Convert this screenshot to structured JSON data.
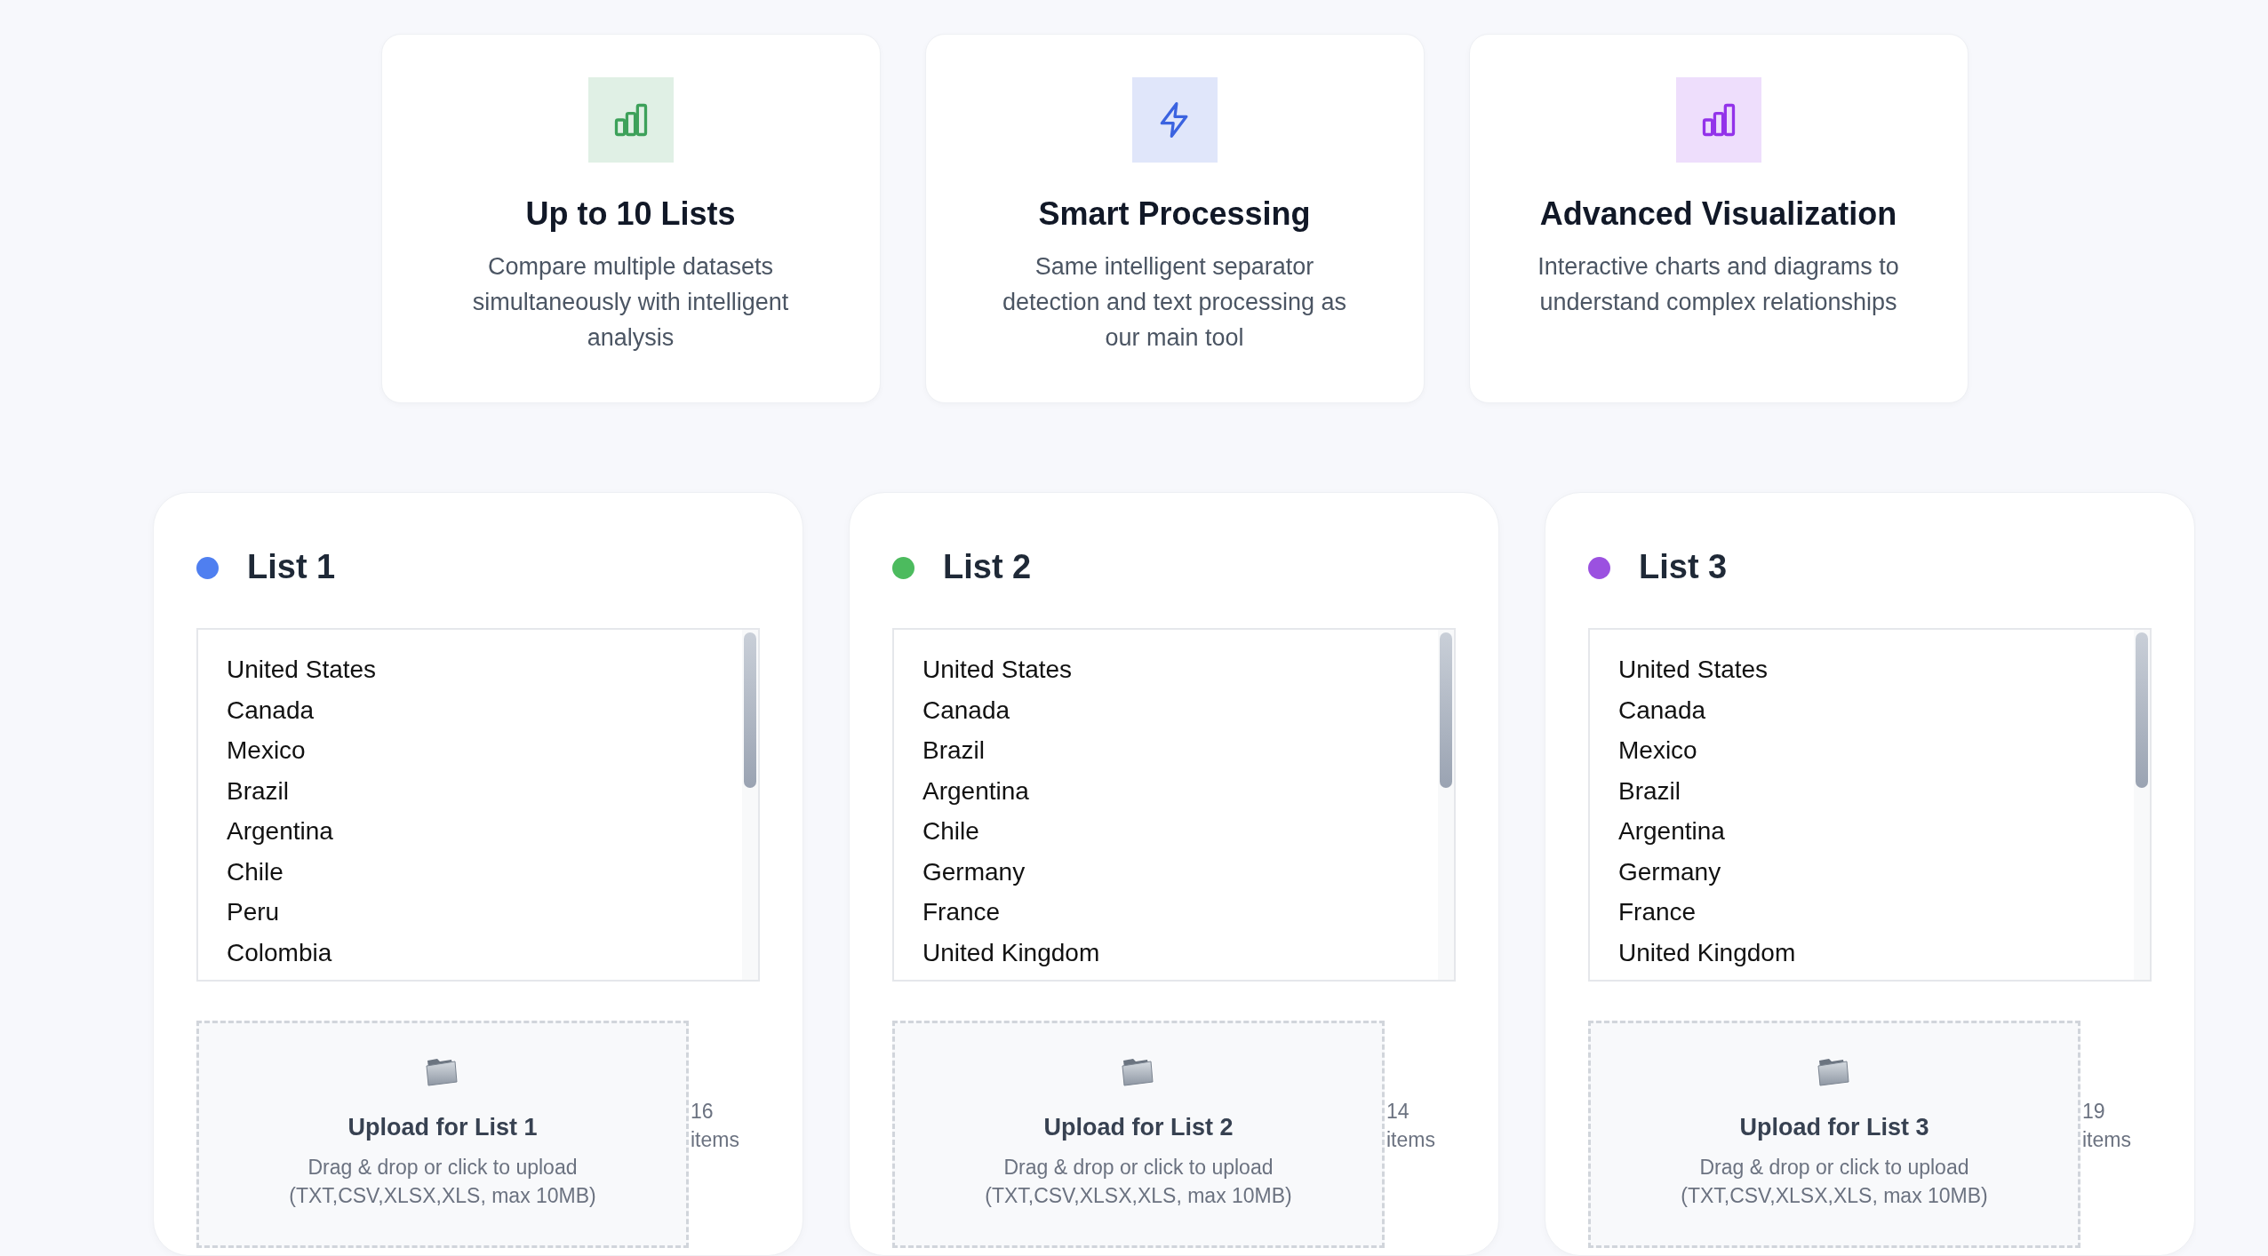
{
  "features": [
    {
      "kind": "chart",
      "color": "#3da15a",
      "title": "Up to 10 Lists",
      "description": "Compare multiple datasets simultaneously with intelligent analysis"
    },
    {
      "kind": "bolt",
      "color": "#3b63e0",
      "title": "Smart Processing",
      "description": "Same intelligent separator detection and text processing as our main tool"
    },
    {
      "kind": "chart",
      "color": "#9333ea",
      "title": "Advanced Visualization",
      "description": "Interactive charts and diagrams to understand complex relationships"
    }
  ],
  "lists": [
    {
      "title": "List 1",
      "color": "#4f7ff0",
      "items": [
        "United States",
        "Canada",
        "Mexico",
        "Brazil",
        "Argentina",
        "Chile",
        "Peru",
        "Colombia"
      ],
      "upload_title": "Upload for List 1",
      "upload_hint": "Drag & drop or click to upload",
      "upload_formats": "(TXT,CSV,XLSX,XLS, max 10MB)",
      "count": "16 items"
    },
    {
      "title": "List 2",
      "color": "#4cbb5e",
      "items": [
        "United States",
        "Canada",
        "Brazil",
        "Argentina",
        "Chile",
        "Germany",
        "France",
        "United Kingdom"
      ],
      "upload_title": "Upload for List 2",
      "upload_hint": "Drag & drop or click to upload",
      "upload_formats": "(TXT,CSV,XLSX,XLS, max 10MB)",
      "count": "14 items"
    },
    {
      "title": "List 3",
      "color": "#9b51e0",
      "items": [
        "United States",
        "Canada",
        "Mexico",
        "Brazil",
        "Argentina",
        "Germany",
        "France",
        "United Kingdom"
      ],
      "upload_title": "Upload for List 3",
      "upload_hint": "Drag & drop or click to upload",
      "upload_formats": "(TXT,CSV,XLSX,XLS, max 10MB)",
      "count": "19 items"
    }
  ]
}
